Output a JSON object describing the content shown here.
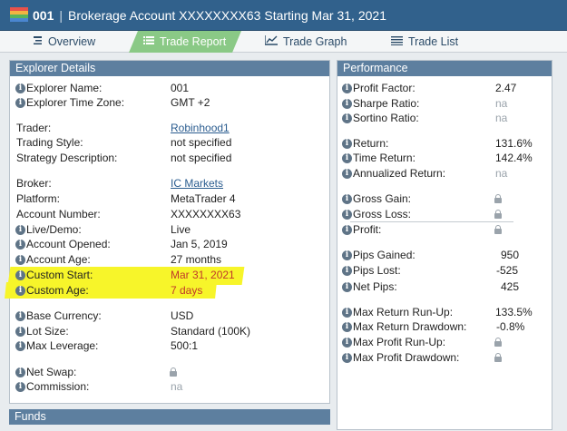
{
  "title": {
    "id": "001",
    "separator": "|",
    "text": "Brokerage Account XXXXXXXX63 Starting Mar 31, 2021"
  },
  "nav": {
    "tabs": [
      {
        "label": "Overview",
        "icon": "overview-icon"
      },
      {
        "label": "Trade Report",
        "icon": "list-icon",
        "active": true
      },
      {
        "label": "Trade Graph",
        "icon": "graph-icon"
      },
      {
        "label": "Trade List",
        "icon": "lines-icon"
      }
    ]
  },
  "explorer": {
    "header": "Explorer Details",
    "rows": [
      {
        "label": "Explorer Name:",
        "value": "001",
        "info": true
      },
      {
        "label": "Explorer Time Zone:",
        "value": "GMT +2",
        "info": true
      },
      {
        "label": "Trader:",
        "value": "Robinhood1",
        "info": false
      },
      {
        "label": "Trading Style:",
        "value": "not specified",
        "info": false
      },
      {
        "label": "Strategy Description:",
        "value": "not specified",
        "info": false
      },
      {
        "label": "Broker:",
        "value": "IC Markets",
        "info": false
      },
      {
        "label": "Platform:",
        "value": "MetaTrader 4",
        "info": false
      },
      {
        "label": "Account Number:",
        "value": "XXXXXXXX63",
        "info": false
      },
      {
        "label": "Live/Demo:",
        "value": "Live",
        "info": true
      },
      {
        "label": "Account Opened:",
        "value": "Jan 5, 2019",
        "info": true
      },
      {
        "label": "Account Age:",
        "value": "27 months",
        "info": true
      },
      {
        "label": "Custom Start:",
        "value": "Mar 31, 2021",
        "info": true
      },
      {
        "label": "Custom Age:",
        "value": "7 days",
        "info": true
      },
      {
        "label": "Base Currency:",
        "value": "USD",
        "info": true
      },
      {
        "label": "Lot Size:",
        "value": "Standard (100K)",
        "info": true
      },
      {
        "label": "Max Leverage:",
        "value": "500:1",
        "info": true
      },
      {
        "label": "Net Swap:",
        "value": "",
        "info": true,
        "locked": true
      },
      {
        "label": "Commission:",
        "value": "na",
        "info": true
      }
    ]
  },
  "performance": {
    "header": "Performance",
    "rows": [
      {
        "label": "Profit Factor:",
        "value": "2.47"
      },
      {
        "label": "Sharpe Ratio:",
        "value": "na"
      },
      {
        "label": "Sortino Ratio:",
        "value": "na"
      },
      {
        "label": "Return:",
        "value": "131.6%"
      },
      {
        "label": "Time Return:",
        "value": "142.4%"
      },
      {
        "label": "Annualized Return:",
        "value": "na"
      },
      {
        "label": "Gross Gain:",
        "value": "",
        "locked": true
      },
      {
        "label": "Gross Loss:",
        "value": "",
        "locked": true
      },
      {
        "label": "Profit:",
        "value": "",
        "locked": true
      },
      {
        "label": "Pips Gained:",
        "value": "950"
      },
      {
        "label": "Pips Lost:",
        "value": "-525"
      },
      {
        "label": "Net Pips:",
        "value": "425"
      },
      {
        "label": "Max Return Run-Up:",
        "value": "133.5%"
      },
      {
        "label": "Max Return Drawdown:",
        "value": "-0.8%"
      },
      {
        "label": "Max Profit Run-Up:",
        "value": "",
        "locked": true
      },
      {
        "label": "Max Profit Drawdown:",
        "value": "",
        "locked": true
      }
    ]
  },
  "funds": {
    "header": "Funds"
  },
  "colors": {
    "titlebar": "#31618c",
    "panel_header": "#5d7f9f",
    "active_tab": "#8ac986",
    "highlight": "#f7f52a",
    "highlight_text": "#c0392b",
    "link": "#2a5c8f"
  }
}
